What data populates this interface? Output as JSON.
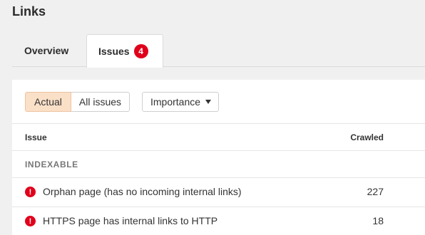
{
  "page": {
    "title": "Links"
  },
  "tabs": [
    {
      "label": "Overview"
    },
    {
      "label": "Issues",
      "badge": "4"
    }
  ],
  "filters": {
    "segments": [
      {
        "label": "Actual",
        "active": true
      },
      {
        "label": "All issues",
        "active": false
      }
    ],
    "dropdown": {
      "label": "Importance"
    }
  },
  "table": {
    "columns": {
      "issue": "Issue",
      "crawled": "Crawled"
    },
    "group": "INDEXABLE",
    "rows": [
      {
        "issue": "Orphan page (has no incoming internal links)",
        "crawled": "227"
      },
      {
        "issue": "HTTPS page has internal links to HTTP",
        "crawled": "18"
      }
    ]
  },
  "colors": {
    "error": "#e0001b",
    "active_segment": "#fbe0c8",
    "background": "#f0f0f0"
  },
  "icons": {
    "error": "error-circle-icon",
    "dropdown": "caret-down-icon"
  }
}
